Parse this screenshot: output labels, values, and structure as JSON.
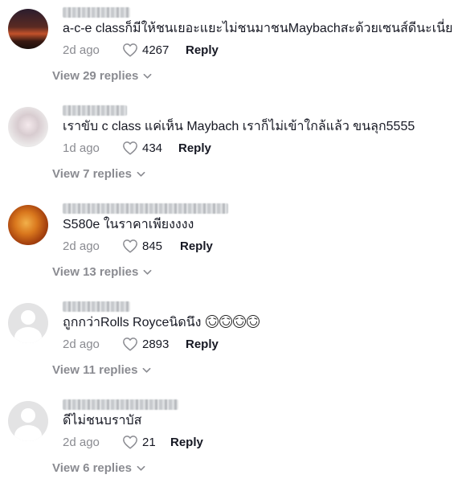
{
  "comments": [
    {
      "text": "a-c-e classก็มีให้ชนเยอะแยะไม่ชนมาชนMaybachสะด้วยเซนส์ดีนะเนี่ย",
      "time": "2d ago",
      "likes": "4267",
      "reply_label": "Reply",
      "view_replies": "View 29 replies",
      "avatar": "sunset-photo"
    },
    {
      "text": "เราขับ c class แค่เห็น Maybach เราก็ไม่เข้าใกล้แล้ว ขนลุก5555",
      "time": "1d ago",
      "likes": "434",
      "reply_label": "Reply",
      "view_replies": "View 7 replies",
      "avatar": "light-photo"
    },
    {
      "text": "S580e ในราคาเพียงงงง",
      "time": "2d ago",
      "likes": "845",
      "reply_label": "Reply",
      "view_replies": "View 13 replies",
      "avatar": "orange-photo"
    },
    {
      "text": "ถูกกว่าRolls Royceนิดนึง",
      "emoji_count": 4,
      "emoji": "rolling-on-floor-laughing",
      "time": "2d ago",
      "likes": "2893",
      "reply_label": "Reply",
      "view_replies": "View 11 replies",
      "avatar": "default-placeholder"
    },
    {
      "text": "ดีไม่ชนบราบัส",
      "time": "2d ago",
      "likes": "21",
      "reply_label": "Reply",
      "view_replies": "View 6 replies",
      "avatar": "default-placeholder"
    }
  ]
}
